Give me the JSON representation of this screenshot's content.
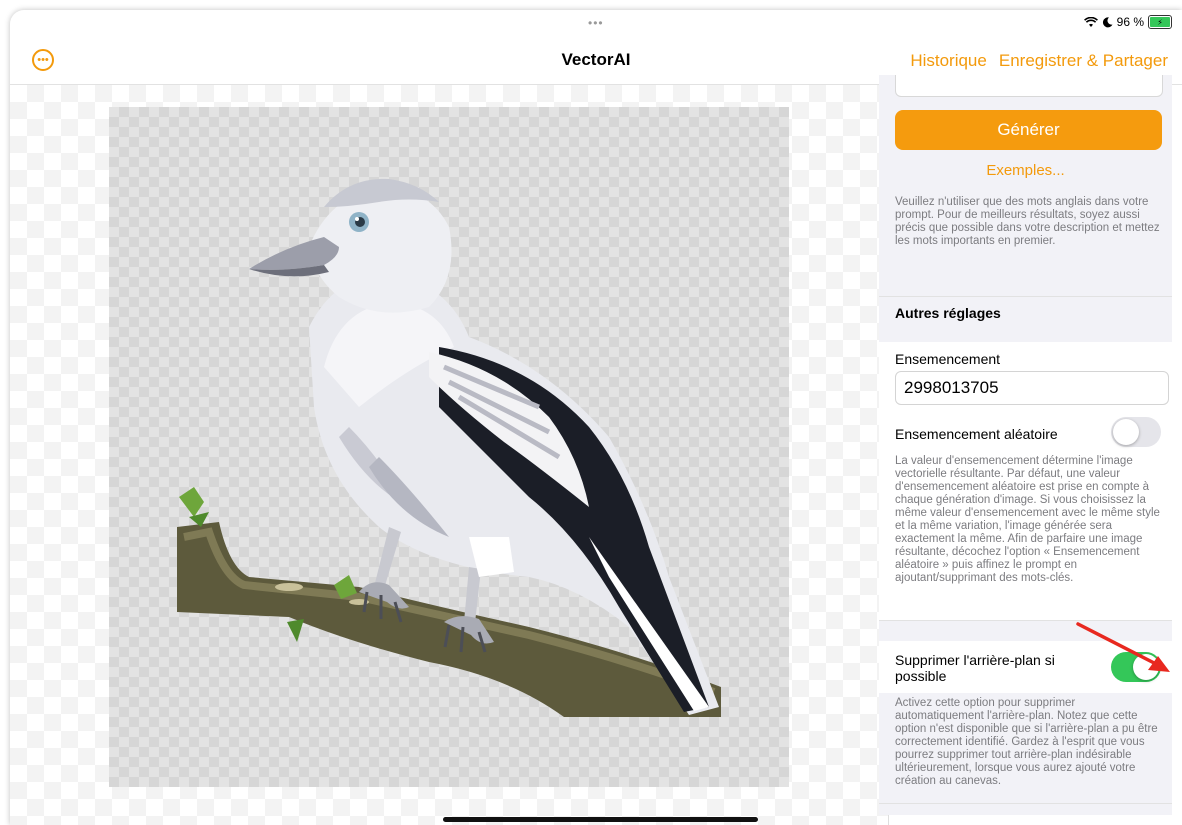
{
  "status_bar": {
    "dots": "•••",
    "battery_percent": "96 %",
    "wifi_icon": "wifi-icon",
    "moon_icon": "moon-icon"
  },
  "nav": {
    "title": "VectorAI",
    "menu_icon": "ellipsis-circle-icon",
    "history": "Historique",
    "save_share": "Enregistrer & Partager"
  },
  "canvas": {
    "image": "crow-on-branch-illustration"
  },
  "panel": {
    "prompt_value": "",
    "generate": "Générer",
    "examples": "Exemples...",
    "prompt_note": "Veuillez n'utiliser que des mots anglais dans votre prompt. Pour de meilleurs résultats, soyez aussi précis que possible dans votre description et mettez les mots importants en premier.",
    "other_settings": "Autres réglages",
    "seed_label": "Ensemencement",
    "seed_value": "2998013705",
    "random_seed_label": "Ensemencement aléatoire",
    "random_seed_on": false,
    "seed_note": "La valeur d'ensemencement détermine l'image vectorielle résultante. Par défaut, une valeur d'ensemencement aléatoire est prise en compte à chaque génération d'image. Si vous choisissez la même valeur d'ensemencement avec le même style et la même variation, l'image générée sera exactement la même. Afin de parfaire une image résultante, décochez l'option « Ensemencement aléatoire » puis affinez le prompt en ajoutant/supprimant des mots-clés.",
    "remove_bg_label": "Supprimer l'arrière-plan si possible",
    "remove_bg_on": true,
    "remove_bg_note": "Activez cette option pour supprimer automatiquement l'arrière-plan. Notez que cette option n'est disponible que si l'arrière-plan a pu être correctement identifié. Gardez à l'esprit que vous pourrez supprimer tout arrière-plan indésirable ultérieurement, lorsque vous aurez ajouté votre création au canevas."
  },
  "colors": {
    "accent": "#f39a0c",
    "toggle_on": "#34c759",
    "annotation_arrow": "#e8281f"
  }
}
